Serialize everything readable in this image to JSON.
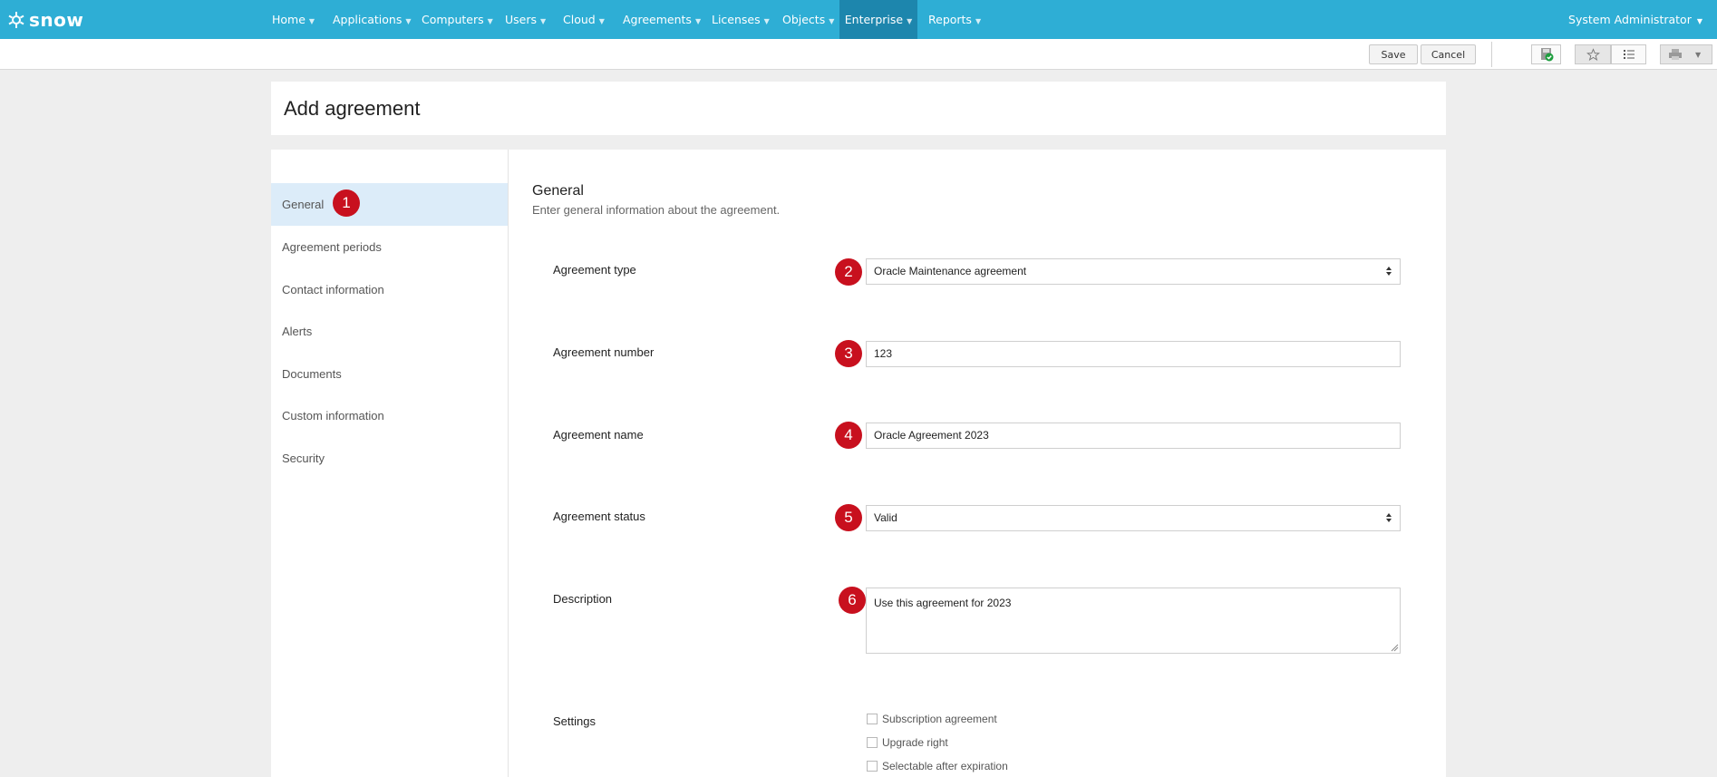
{
  "nav": {
    "logo_text": "snow",
    "items": [
      {
        "label": "Home"
      },
      {
        "label": "Applications"
      },
      {
        "label": "Computers"
      },
      {
        "label": "Users"
      },
      {
        "label": "Cloud"
      },
      {
        "label": "Agreements"
      },
      {
        "label": "Licenses"
      },
      {
        "label": "Objects"
      },
      {
        "label": "Enterprise",
        "active": true
      },
      {
        "label": "Reports"
      }
    ],
    "user": "System Administrator"
  },
  "toolbar": {
    "save_label": "Save",
    "cancel_label": "Cancel",
    "icons": [
      "save-status-icon",
      "star-icon",
      "list-icon",
      "print-icon",
      "chevron-down-icon"
    ]
  },
  "page": {
    "title": "Add agreement"
  },
  "sidebar": {
    "items": [
      {
        "label": "General",
        "active": true
      },
      {
        "label": "Agreement periods"
      },
      {
        "label": "Contact information"
      },
      {
        "label": "Alerts"
      },
      {
        "label": "Documents"
      },
      {
        "label": "Custom information"
      },
      {
        "label": "Security"
      }
    ]
  },
  "form": {
    "section_title": "General",
    "section_subtitle": "Enter general information about the agreement.",
    "fields": {
      "agreement_type": {
        "label": "Agreement type",
        "value": "Oracle Maintenance agreement"
      },
      "agreement_number": {
        "label": "Agreement number",
        "value": "123"
      },
      "agreement_name": {
        "label": "Agreement name",
        "value": "Oracle Agreement 2023"
      },
      "agreement_status": {
        "label": "Agreement status",
        "value": "Valid"
      },
      "description": {
        "label": "Description",
        "value": "Use this agreement for 2023"
      }
    },
    "settings": {
      "label": "Settings",
      "options": [
        {
          "label": "Subscription agreement",
          "checked": false
        },
        {
          "label": "Upgrade right",
          "checked": false
        },
        {
          "label": "Selectable after expiration",
          "checked": false
        }
      ]
    }
  },
  "badges": [
    "1",
    "2",
    "3",
    "4",
    "5",
    "6"
  ],
  "colors": {
    "nav_bg": "#2eaed5",
    "nav_active": "#1d86ad",
    "badge": "#c8101e",
    "sidebar_active": "#dcecf9"
  }
}
